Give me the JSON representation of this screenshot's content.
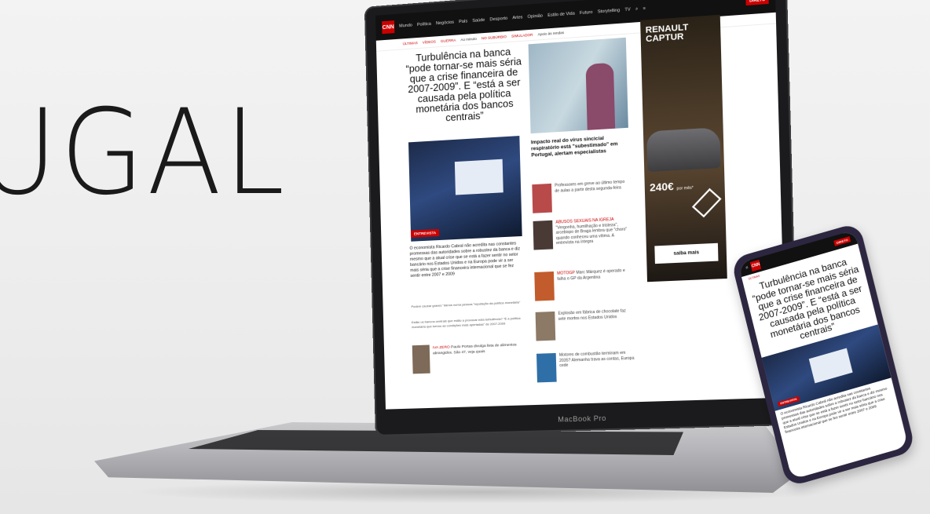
{
  "hero": {
    "big_text": "UGAL"
  },
  "laptop": {
    "brand_label": "MacBook Pro",
    "site": {
      "logo": "CNN",
      "nav": [
        "Mundo",
        "Política",
        "Negócios",
        "País",
        "Saúde",
        "Desporto",
        "Artes",
        "Opinião",
        "Estilo de Vida",
        "Futuro",
        "Storytelling",
        "TV"
      ],
      "live_label": "DIRETO",
      "ticker": [
        {
          "tag": "ÚLTIMAS",
          "text": ""
        },
        {
          "tag": "VÍDEOS",
          "text": ""
        },
        {
          "tag": "GUERRA",
          "text": "Ao minuto"
        },
        {
          "tag": "NO SUBÚRBIO",
          "text": ""
        },
        {
          "tag": "SIMULADOR",
          "text": "Apoio às rendas"
        }
      ],
      "main_headline": "Turbulência na banca “pode tornar-se mais séria que a crise financeira de 2007-2009”. E “está a ser causada pela política monetária dos bancos centrais”",
      "badge": "ENTREVISTA",
      "lead": "O economista Ricardo Cabral não acredita nas constantes promessas das autoridades sobre a robustez da banca e diz mesmo que a atual crise que se está a fazer sentir no setor bancário nos Estados Unidos e na Europa pode vir a ser mais séria que a crise financeira internacional que se fez sentir entre 2007 e 2009",
      "bullets": [
        "Podem causar graves \"danos numa pessoa \"reputação da política monetária\"",
        "Estão os bancos centrais que estão a provocar esta turbulência? \"É a política monetária que tornou as condições mais apertadas\" de 2007-2009"
      ],
      "bottom_story": {
        "tag": "IVA ZERO",
        "text": "Paulo Portas divulga lista de alimentos abrangidos. São 47, veja quais"
      },
      "second_story": "Impacto real do vírus sincicial respiratório está \"subestimado\" em Portugal, alertam especialistas",
      "side_stories": [
        {
          "tag": "",
          "text": "Professores em greve ao último tempo de aulas a partir desta segunda-feira"
        },
        {
          "tag": "ABUSOS SEXUAIS NA IGREJA",
          "text": "\"Vergonha, humilhação e tristeza\", arcebispo de Braga lembra que \"choro\" quando conheceu uma vítima. A entrevista na íntegra"
        },
        {
          "tag": "MOTOGP",
          "text": "Marc Márquez é operado e falha o GP da Argentina"
        },
        {
          "tag": "",
          "text": "Explosão em fábrica de chocolate faz sete mortos nos Estados Unidos"
        },
        {
          "tag": "",
          "text": "Motores de combustão terminam em 2035? Alemanha trava as contas, Europa cede"
        }
      ],
      "ad": {
        "brand": "RENAULT CAPTUR",
        "price": "240€",
        "price_suffix": "por mês*",
        "cta": "saiba mais"
      }
    }
  },
  "phone": {
    "headline": "Turbulência na banca “pode tornar-se mais séria que a crise financeira de 2007-2009”. E “está a ser causada pela política monetária dos bancos centrais”",
    "badge": "ENTREVISTA",
    "lead": "O economista Ricardo Cabral não acredita nas constantes promessas das autoridades sobre a robustez da banca e diz mesmo que a atual crise que se está a fazer sentir no setor bancário nos Estados Unidos e na Europa pode vir a ser mais séria que a crise financeira internacional que se fez sentir entre 2007 e 2009"
  }
}
